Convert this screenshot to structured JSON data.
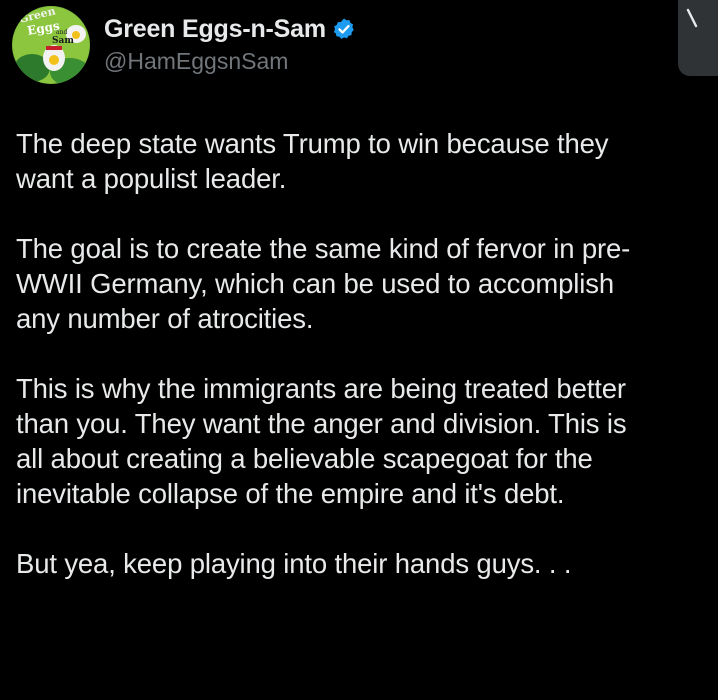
{
  "author": {
    "display_name": "Green Eggs-n-Sam",
    "handle": "@HamEggsnSam",
    "verified": true,
    "avatar_text_line1": "Green",
    "avatar_text_line2": "Eggs",
    "avatar_text_line3": "and",
    "avatar_text_line4": "Sam"
  },
  "post": {
    "paragraphs": [
      "The deep state wants Trump to win because they\nwant a populist leader.",
      "The goal is to create the same kind of fervor in pre-\nWWII Germany, which can be used to accomplish\nany number of atrocities.",
      "This is why the immigrants are being treated better\nthan you. They want the anger and division. This is\nall about creating a believable scapegoat for the\ninevitable collapse of the empire and it's debt.",
      "But yea, keep playing into their hands guys. . ."
    ]
  },
  "colors": {
    "background": "#000000",
    "text": "#e7e9ea",
    "muted": "#71767b",
    "verified": "#1d9bf0"
  },
  "icons": {
    "verified": "verified-badge-icon",
    "more": "more-options-icon"
  }
}
